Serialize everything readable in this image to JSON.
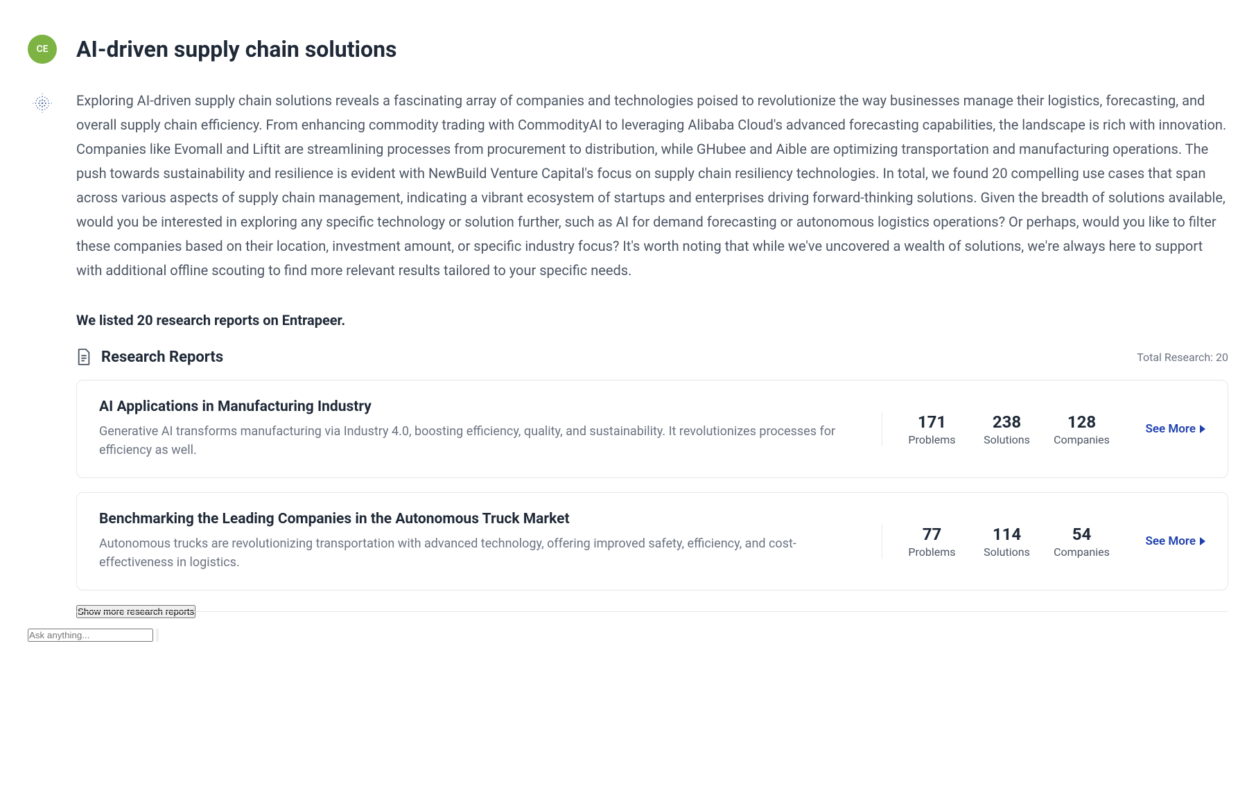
{
  "avatar_initials": "CE",
  "title": "AI-driven supply chain solutions",
  "description": "Exploring AI-driven supply chain solutions reveals a fascinating array of companies and technologies poised to revolutionize the way businesses manage their logistics, forecasting, and overall supply chain efficiency. From enhancing commodity trading with CommodityAI to leveraging Alibaba Cloud's advanced forecasting capabilities, the landscape is rich with innovation. Companies like Evomall and Liftit are streamlining processes from procurement to distribution, while GHubee and Aible are optimizing transportation and manufacturing operations. The push towards sustainability and resilience is evident with NewBuild Venture Capital's focus on supply chain resiliency technologies. In total, we found 20 compelling use cases that span across various aspects of supply chain management, indicating a vibrant ecosystem of startups and enterprises driving forward-thinking solutions. Given the breadth of solutions available, would you be interested in exploring any specific technology or solution further, such as AI for demand forecasting or autonomous logistics operations? Or perhaps, would you like to filter these companies based on their location, investment amount, or specific industry focus? It's worth noting that while we've uncovered a wealth of solutions, we're always here to support with additional offline scouting to find more relevant results tailored to your specific needs.",
  "subtitle": "We listed 20 research reports on Entrapeer.",
  "section": {
    "title": "Research Reports",
    "total_label": "Total Research: 20"
  },
  "reports": [
    {
      "title": "AI Applications in Manufacturing Industry",
      "desc": "Generative AI transforms manufacturing via Industry 4.0, boosting efficiency, quality, and sustainability. It revolutionizes processes for efficiency as well.",
      "problems": "171",
      "solutions": "238",
      "companies": "128"
    },
    {
      "title": "Benchmarking the Leading Companies in the Autonomous Truck Market",
      "desc": "Autonomous trucks are revolutionizing transportation with advanced technology, offering improved safety, efficiency, and cost-effectiveness in logistics.",
      "problems": "77",
      "solutions": "114",
      "companies": "54"
    }
  ],
  "labels": {
    "problems": "Problems",
    "solutions": "Solutions",
    "companies": "Companies",
    "see_more": "See More",
    "show_more": "Show more research reports"
  },
  "input": {
    "placeholder": "Ask anything..."
  }
}
